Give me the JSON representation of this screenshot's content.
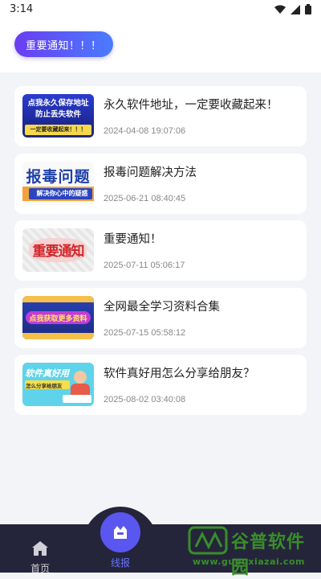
{
  "status_bar": {
    "time": "3:14"
  },
  "notice_button": {
    "label": "重要通知！！！"
  },
  "articles": [
    {
      "title": "永久软件地址，一定要收藏起来！",
      "time": "2024-04-08 19:07:06",
      "thumb": {
        "line1": "点我永久保存地址",
        "line2": "防止丢失软件",
        "line3": "一定要收藏起来！！！"
      }
    },
    {
      "title": "报毒问题解决方法",
      "time": "2025-06-21 08:40:45",
      "thumb": {
        "line1": "报毒问题",
        "line2": "解决你心中的疑惑"
      }
    },
    {
      "title": "重要通知！",
      "time": "2025-07-11 05:06:17",
      "thumb": {
        "line1": "重要通知"
      }
    },
    {
      "title": "全网最全学习资料合集",
      "time": "2025-07-15 05:58:12",
      "thumb": {
        "line1": "点我获取更多资料"
      }
    },
    {
      "title": "软件真好用怎么分享给朋友？",
      "time": "2025-08-02 03:40:08",
      "thumb": {
        "line1": "软件真好用",
        "line2": "怎么分享给朋友"
      }
    }
  ],
  "tabbar": {
    "home_label": "首页",
    "news_label": "线报"
  },
  "watermark": {
    "title": "谷普软件园",
    "url": "www.gupuxiazai.com"
  },
  "colors": {
    "accent": "#5a56f0",
    "tabbar_bg": "#24253a",
    "tab_active": "#6b74ff"
  }
}
